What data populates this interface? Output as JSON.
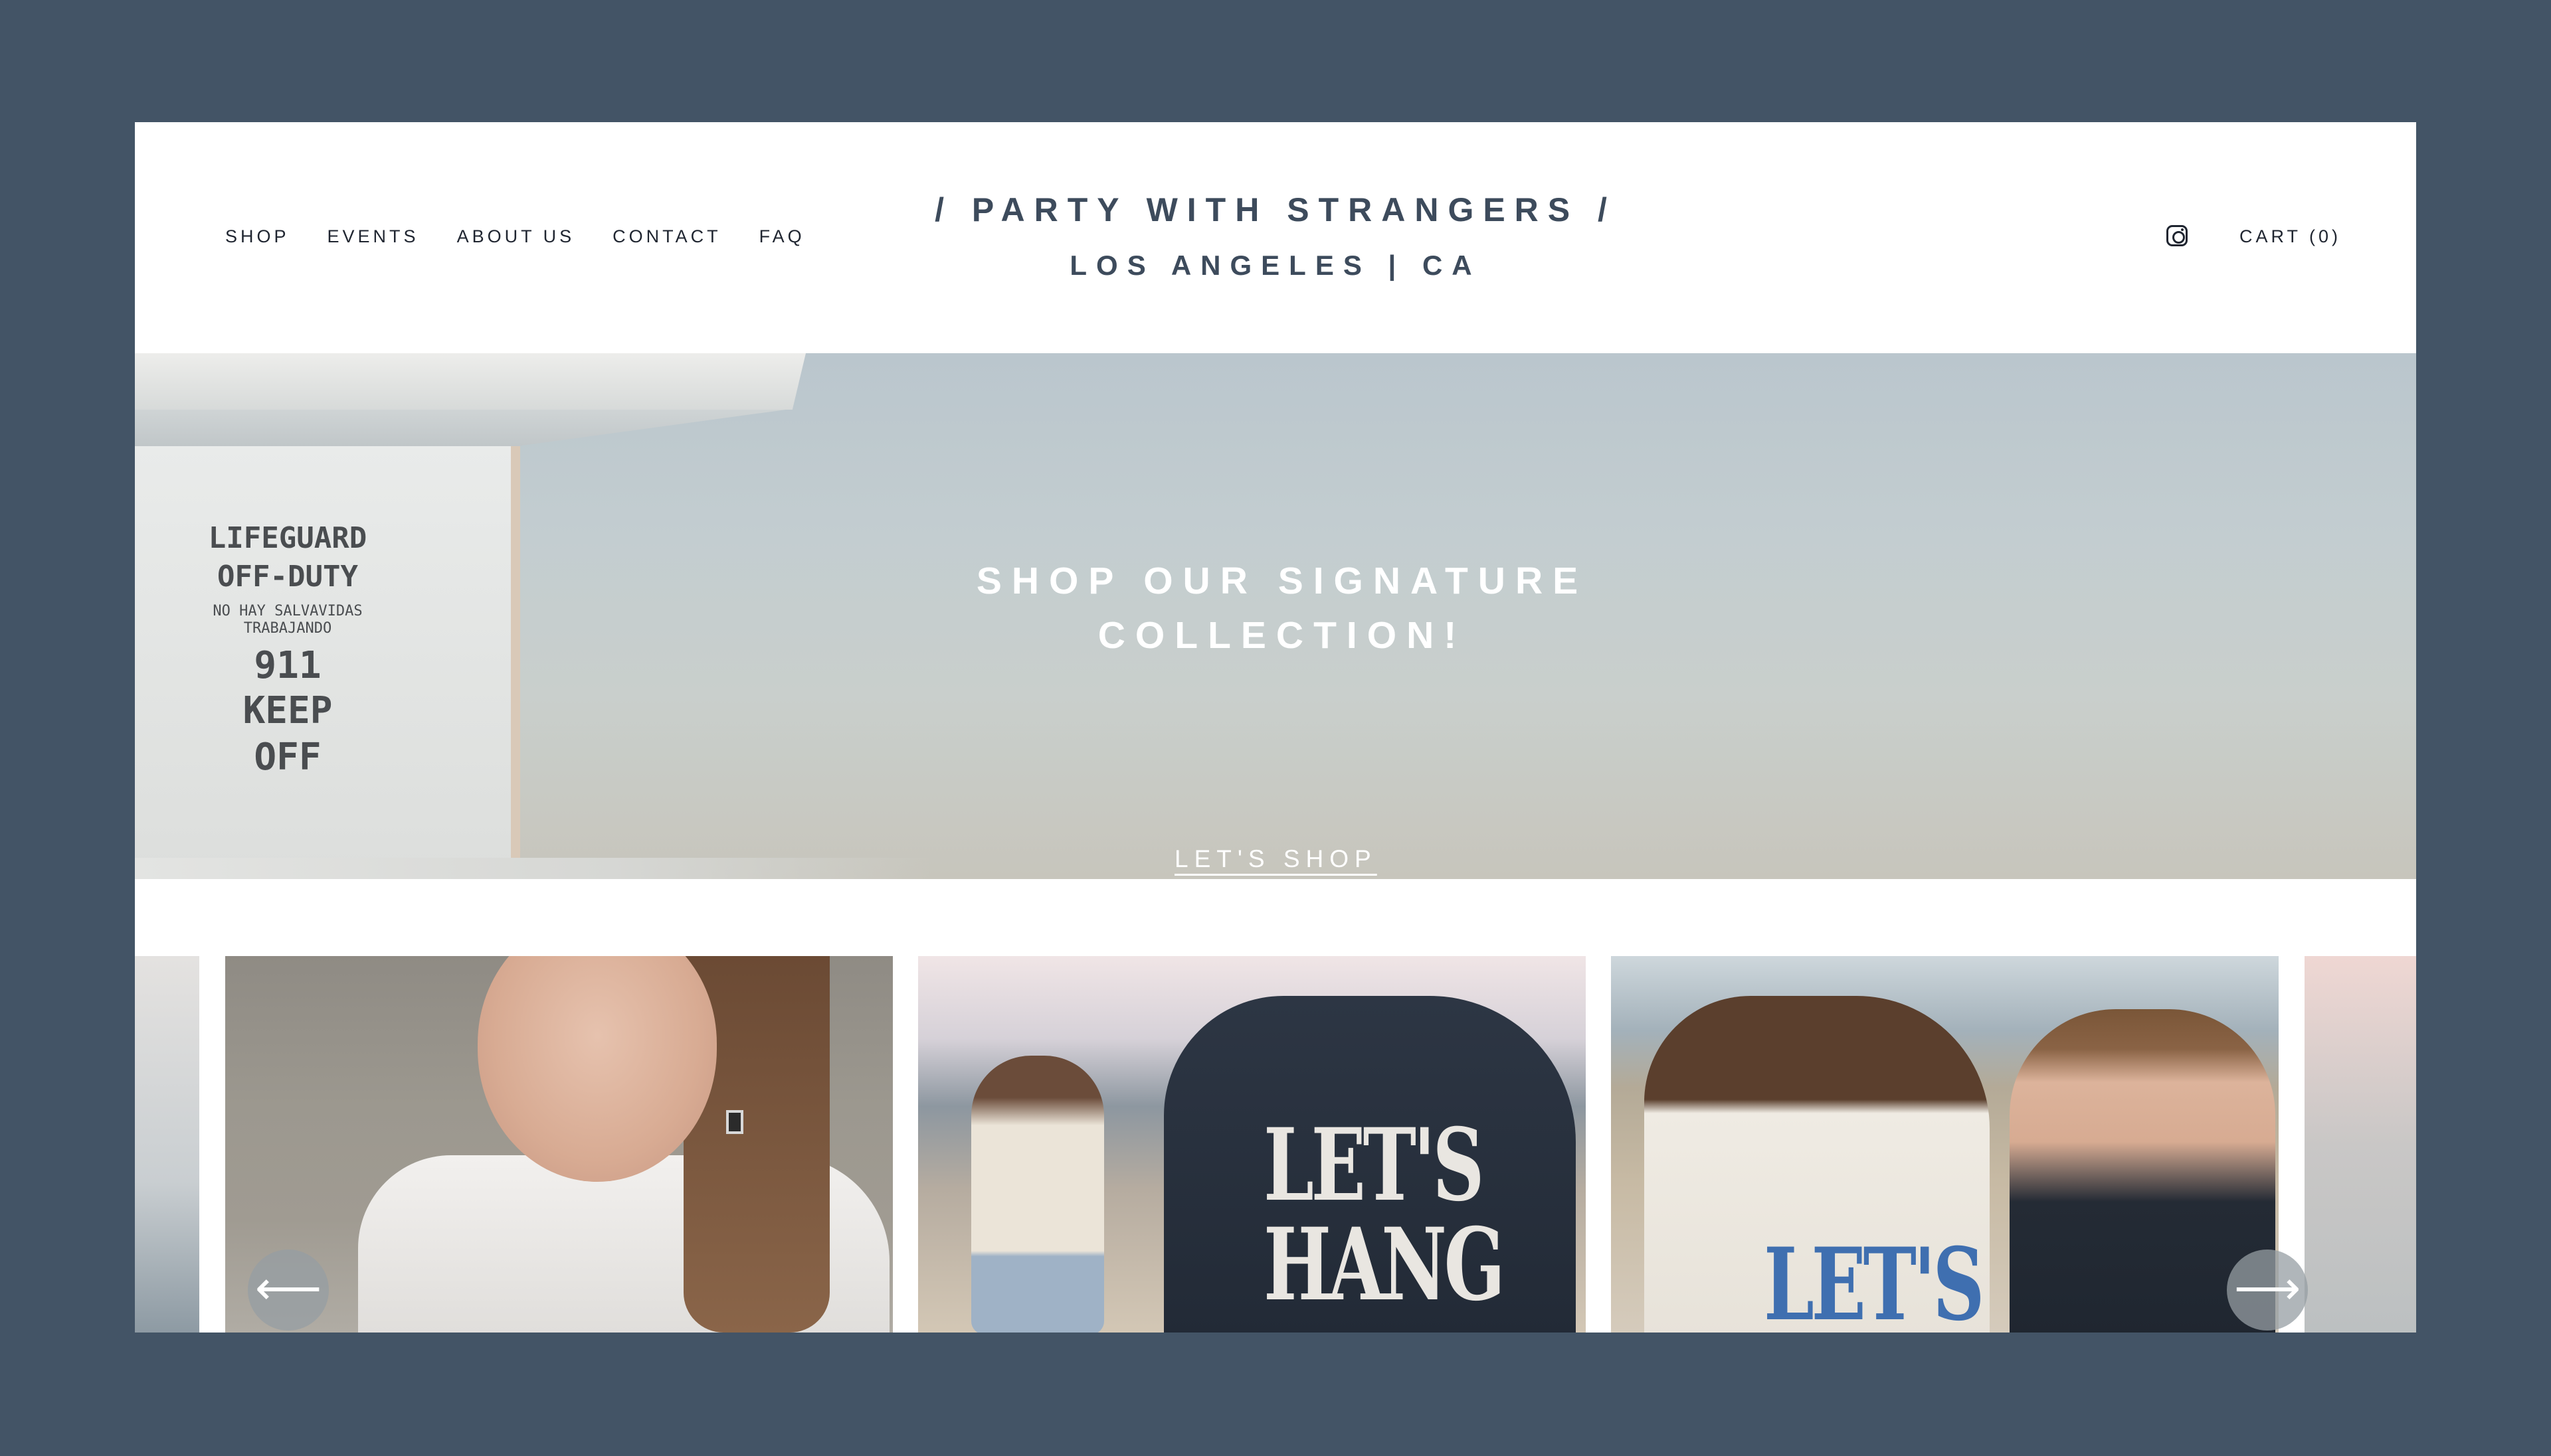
{
  "header": {
    "nav": [
      {
        "label": "SHOP"
      },
      {
        "label": "EVENTS"
      },
      {
        "label": "ABOUT US"
      },
      {
        "label": "CONTACT"
      },
      {
        "label": "FAQ"
      }
    ],
    "brand_title": "/ PARTY WITH STRANGERS /",
    "brand_subtitle": "LOS ANGELES | CA",
    "instagram_icon": "instagram-icon",
    "cart_label": "CART (0)"
  },
  "hero": {
    "sign_line1": "LIFEGUARD OFF-DUTY",
    "sign_line2": "NO HAY SALVAVIDAS TRABAJANDO",
    "sign_line3": "911",
    "sign_line4": "KEEP OFF",
    "heading": "SHOP OUR SIGNATURE COLLECTION!",
    "cta_label": "LET'S SHOP"
  },
  "carousel": {
    "slides": [
      {
        "print": ""
      },
      {
        "print": ""
      },
      {
        "print": "LET'S HANG"
      },
      {
        "print": "LET'S"
      },
      {
        "print": ""
      }
    ],
    "prev_icon": "arrow-left-icon",
    "next_icon": "arrow-right-icon",
    "prev_glyph": "⟵",
    "next_glyph": "⟶"
  },
  "colors": {
    "page_background": "#435466",
    "brand_text": "#3d4b5c",
    "nav_text": "#1f2530"
  }
}
